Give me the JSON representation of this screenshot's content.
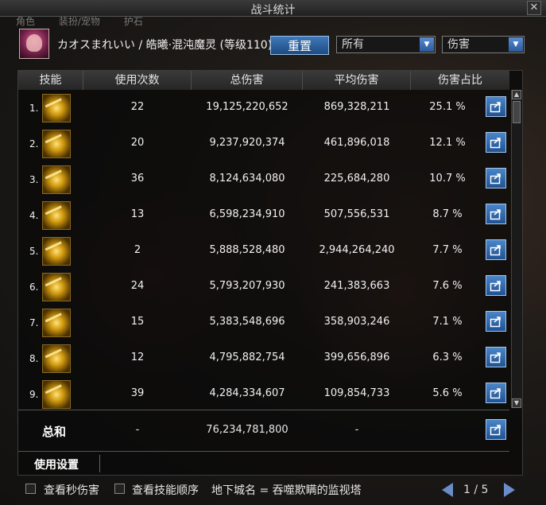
{
  "window": {
    "title": "战斗统计",
    "close_label": "✕"
  },
  "behind_tabs": [
    "角色",
    "装扮/宠物",
    "护石"
  ],
  "header": {
    "character": "カオスまれいい / 皓曦·混沌魔灵 (等级110)",
    "reset_label": "重置",
    "filter_select": "所有",
    "metric_select": "伤害"
  },
  "table": {
    "columns": [
      "技能",
      "使用次数",
      "总伤害",
      "平均伤害",
      "伤害占比"
    ],
    "rows": [
      {
        "rank": "1.",
        "icon": "skill-icon-1",
        "uses": "22",
        "total": "19,125,220,652",
        "average": "869,328,211",
        "share": "25.1 %"
      },
      {
        "rank": "2.",
        "icon": "skill-icon-2",
        "uses": "20",
        "total": "9,237,920,374",
        "average": "461,896,018",
        "share": "12.1 %"
      },
      {
        "rank": "3.",
        "icon": "skill-icon-3",
        "uses": "36",
        "total": "8,124,634,080",
        "average": "225,684,280",
        "share": "10.7 %"
      },
      {
        "rank": "4.",
        "icon": "skill-icon-4",
        "uses": "13",
        "total": "6,598,234,910",
        "average": "507,556,531",
        "share": "8.7 %"
      },
      {
        "rank": "5.",
        "icon": "skill-icon-5",
        "uses": "2",
        "total": "5,888,528,480",
        "average": "2,944,264,240",
        "share": "7.7 %"
      },
      {
        "rank": "6.",
        "icon": "skill-icon-6",
        "uses": "24",
        "total": "5,793,207,930",
        "average": "241,383,663",
        "share": "7.6 %"
      },
      {
        "rank": "7.",
        "icon": "skill-icon-7",
        "uses": "15",
        "total": "5,383,548,696",
        "average": "358,903,246",
        "share": "7.1 %"
      },
      {
        "rank": "8.",
        "icon": "skill-icon-8",
        "uses": "12",
        "total": "4,795,882,754",
        "average": "399,656,896",
        "share": "6.3 %"
      },
      {
        "rank": "9.",
        "icon": "skill-icon-9",
        "uses": "39",
        "total": "4,284,334,607",
        "average": "109,854,733",
        "share": "5.6 %"
      }
    ],
    "total": {
      "label": "总和",
      "uses": "-",
      "total": "76,234,781,800",
      "average": "-"
    }
  },
  "settings_label": "使用设置",
  "footer": {
    "show_dps_label": "查看秒伤害",
    "show_skill_order_label": "查看技能顺序",
    "dungeon_text": "地下城名 = 吞噬欺瞒的监视塔",
    "page_text": "1 / 5"
  },
  "colors": {
    "accent_blue": "#2f65a8",
    "panel_bg": "#0a0a0a"
  }
}
